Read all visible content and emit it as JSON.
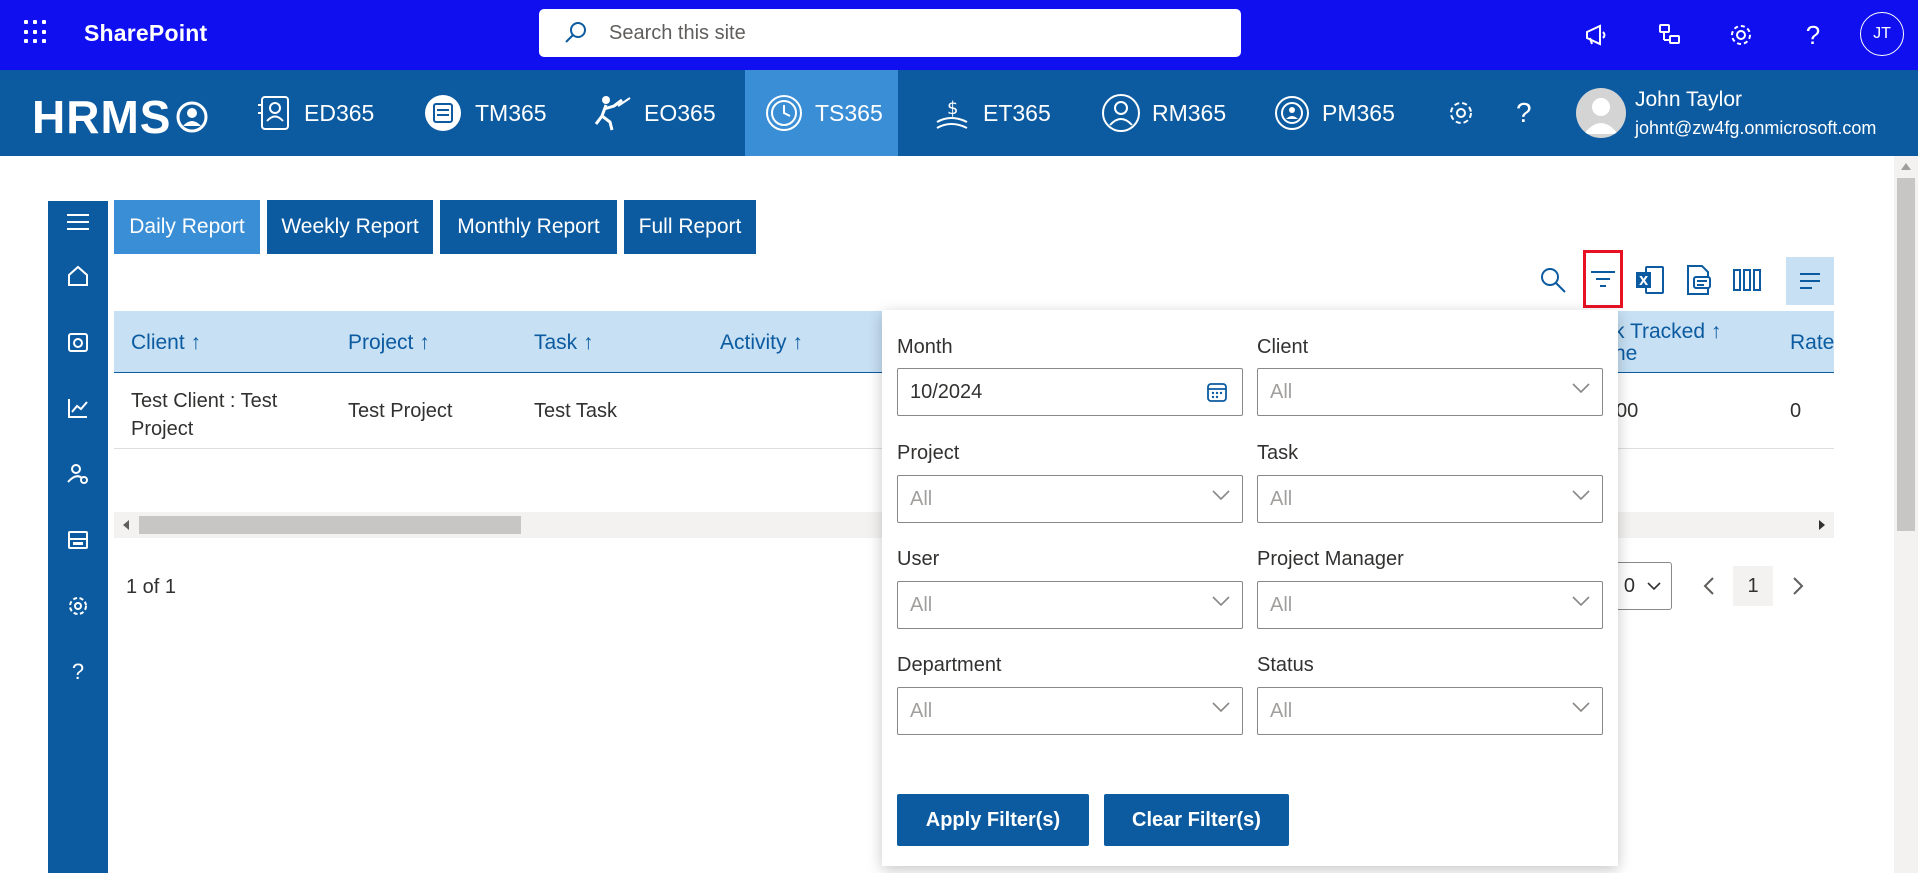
{
  "suite": {
    "title": "SharePoint",
    "search_placeholder": "Search this site",
    "avatar_initials": "JT"
  },
  "app_nav": {
    "logo": "HRMS",
    "items": [
      {
        "label": "ED365"
      },
      {
        "label": "TM365"
      },
      {
        "label": "EO365"
      },
      {
        "label": "TS365",
        "active": true
      },
      {
        "label": "ET365"
      },
      {
        "label": "RM365"
      },
      {
        "label": "PM365"
      }
    ],
    "user": {
      "name": "John Taylor",
      "email": "johnt@zw4fg.onmicrosoft.com"
    }
  },
  "tabs": [
    {
      "label": "Daily Report",
      "active": true
    },
    {
      "label": "Weekly Report"
    },
    {
      "label": "Monthly Report"
    },
    {
      "label": "Full Report"
    }
  ],
  "table": {
    "columns": [
      "Client",
      "Project",
      "Task",
      "Activity",
      "k Tracked",
      "ne",
      "Rate"
    ],
    "row": {
      "client_line1": "Test Client : Test",
      "client_line2": "Project",
      "project": "Test Project",
      "task": "Test Task",
      "tracked": "00",
      "rate": "0"
    }
  },
  "pager": {
    "info": "1 of 1",
    "page_size": "0",
    "current_page": "1"
  },
  "filter_panel": {
    "month": {
      "label": "Month",
      "value": "10/2024"
    },
    "client": {
      "label": "Client",
      "value": "All"
    },
    "project": {
      "label": "Project",
      "value": "All"
    },
    "task": {
      "label": "Task",
      "value": "All"
    },
    "user": {
      "label": "User",
      "value": "All"
    },
    "project_manager": {
      "label": "Project Manager",
      "value": "All"
    },
    "department": {
      "label": "Department",
      "value": "All"
    },
    "status": {
      "label": "Status",
      "value": "All"
    },
    "apply_label": "Apply Filter(s)",
    "clear_label": "Clear Filter(s)"
  },
  "colors": {
    "suite_bar": "#0f0ff0",
    "app_nav": "#0c5ba0",
    "active_tab": "#3a8ed6",
    "table_header": "#c7e0f4",
    "highlight": "#e81123"
  }
}
